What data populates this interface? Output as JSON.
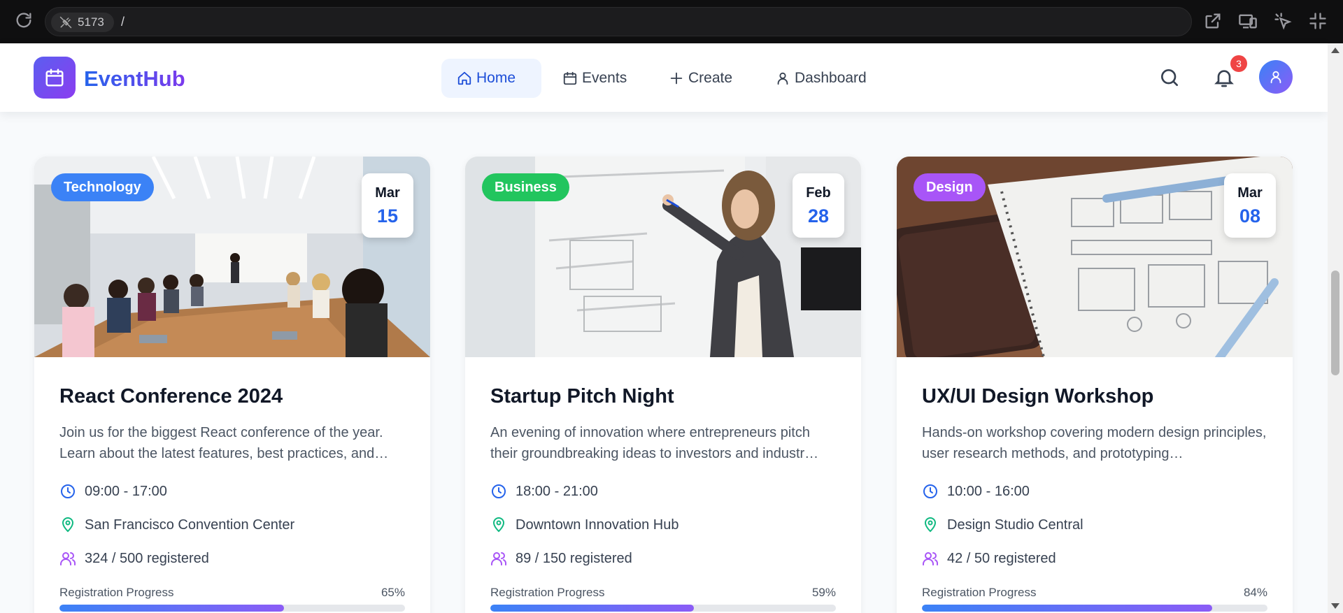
{
  "browser": {
    "port": "5173",
    "path": "/"
  },
  "header": {
    "brand": "EventHub",
    "nav": [
      {
        "label": "Home",
        "icon": "home-icon",
        "active": true
      },
      {
        "label": "Events",
        "icon": "calendar-icon",
        "active": false
      },
      {
        "label": "Create",
        "icon": "plus-icon",
        "active": false
      },
      {
        "label": "Dashboard",
        "icon": "user-icon",
        "active": false
      }
    ],
    "notifications_count": "3"
  },
  "events": [
    {
      "category": "Technology",
      "category_color": "#3b82f6",
      "month": "Mar",
      "day": "15",
      "title": "React Conference 2024",
      "description": "Join us for the biggest React conference of the year. Learn about the latest features, best practices, and…",
      "time": "09:00 - 17:00",
      "location": "San Francisco Convention Center",
      "registered": "324 / 500 registered",
      "progress_label": "Registration Progress",
      "progress_pct": "65%",
      "progress": 0.65
    },
    {
      "category": "Business",
      "category_color": "#22c55e",
      "month": "Feb",
      "day": "28",
      "title": "Startup Pitch Night",
      "description": "An evening of innovation where entrepreneurs pitch their groundbreaking ideas to investors and industr…",
      "time": "18:00 - 21:00",
      "location": "Downtown Innovation Hub",
      "registered": "89 / 150 registered",
      "progress_label": "Registration Progress",
      "progress_pct": "59%",
      "progress": 0.59
    },
    {
      "category": "Design",
      "category_color": "#a855f7",
      "month": "Mar",
      "day": "08",
      "title": "UX/UI Design Workshop",
      "description": "Hands-on workshop covering modern design principles, user research methods, and prototyping…",
      "time": "10:00 - 16:00",
      "location": "Design Studio Central",
      "registered": "42 / 50 registered",
      "progress_label": "Registration Progress",
      "progress_pct": "84%",
      "progress": 0.84
    }
  ]
}
